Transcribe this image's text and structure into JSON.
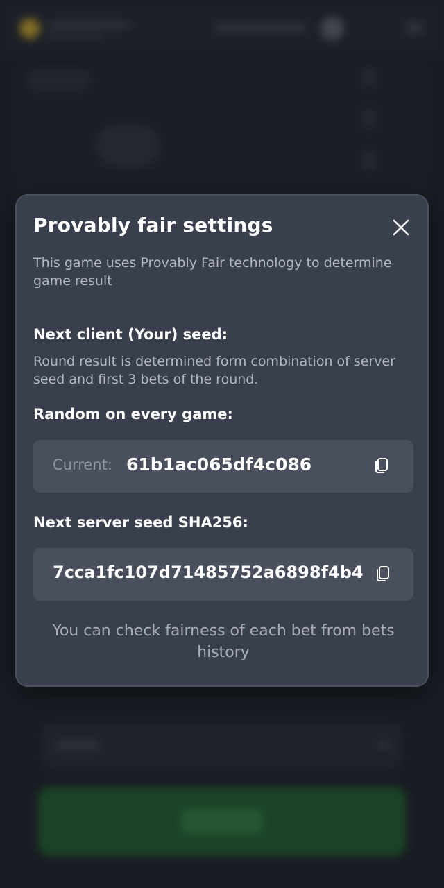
{
  "modal": {
    "title": "Provably fair settings",
    "intro": "This game uses Provably Fair technology to determine game result",
    "client_seed_heading": "Next client (Your) seed:",
    "client_seed_description": "Round result is determined form combination of server seed and first 3 bets of the round.",
    "random_heading": "Random on every game:",
    "current_label": "Current:",
    "current_seed": "61b1ac065df4c086",
    "server_seed_heading": "Next server seed SHA256:",
    "server_seed": "7cca1fc107d71485752a6898f4b4",
    "footer_note": "You can check fairness of each bet from bets history",
    "icons": {
      "close": "close-icon",
      "copy": "copy-icon"
    }
  },
  "colors": {
    "modal_background": "#3a3f4d",
    "field_background": "#4a4f5d",
    "play_button": "#1f5a2c"
  }
}
